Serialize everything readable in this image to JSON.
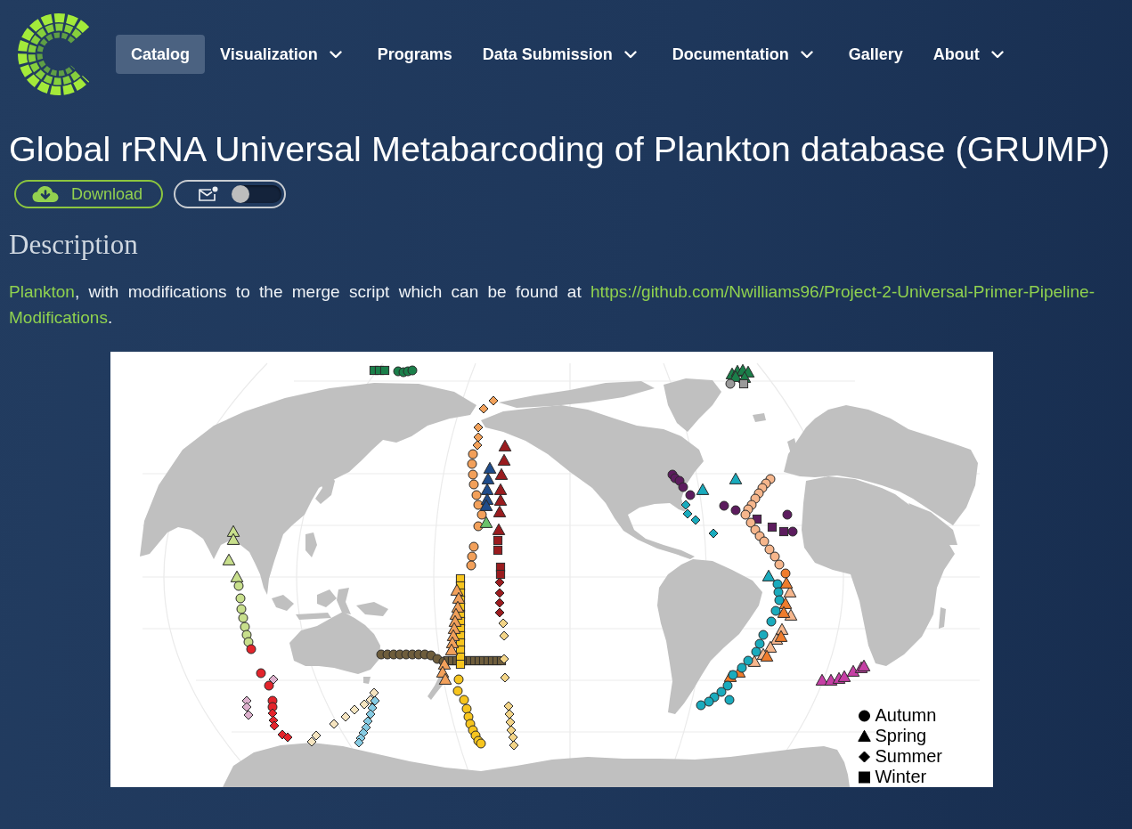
{
  "nav": {
    "items": [
      {
        "label": "Catalog",
        "selected": true,
        "has_dropdown": false
      },
      {
        "label": "Visualization",
        "selected": false,
        "has_dropdown": true
      },
      {
        "label": "Programs",
        "selected": false,
        "has_dropdown": false
      },
      {
        "label": "Data Submission",
        "selected": false,
        "has_dropdown": true
      },
      {
        "label": "Documentation",
        "selected": false,
        "has_dropdown": true
      },
      {
        "label": "Gallery",
        "selected": false,
        "has_dropdown": false
      },
      {
        "label": "About",
        "selected": false,
        "has_dropdown": true
      }
    ]
  },
  "title": "Global rRNA Universal Metabarcoding of Plankton database (GRUMP)",
  "actions": {
    "download": {
      "label": "Download"
    },
    "notify_toggle": {
      "on": false
    }
  },
  "description": {
    "heading": "Description",
    "parts": [
      {
        "kind": "link",
        "text": "Plankton"
      },
      {
        "kind": "text",
        "text": ", with modifications to the merge script which can be found at "
      },
      {
        "kind": "link",
        "text": "https://github.com/Nwilliams96/Project-2-Universal-Primer-Pipeline-"
      },
      {
        "kind": "link",
        "text": "Modifications"
      },
      {
        "kind": "text",
        "text": "."
      }
    ]
  },
  "figure": {
    "legend": [
      {
        "label": "Autumn",
        "kind": "circle"
      },
      {
        "label": "Spring",
        "kind": "triangle"
      },
      {
        "label": "Summer",
        "kind": "diamond"
      },
      {
        "label": "Winter",
        "kind": "square"
      }
    ]
  }
}
